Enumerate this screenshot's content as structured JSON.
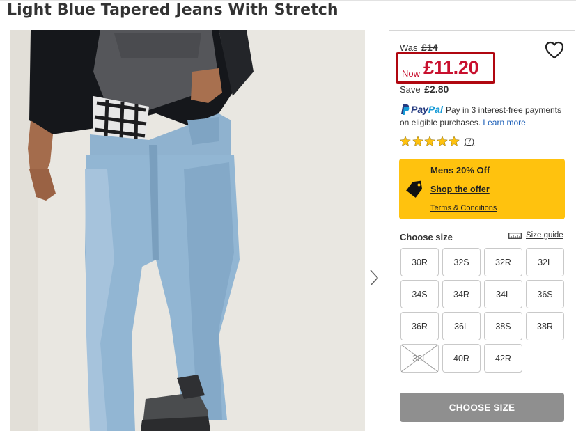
{
  "product": {
    "title": "Light Blue Tapered Jeans With Stretch"
  },
  "pricing": {
    "was_label": "Was",
    "was_price": "£14",
    "now_label": "Now",
    "now_price": "£11.20",
    "save_label": "Save",
    "save_amount": "£2.80"
  },
  "paypal": {
    "brand_pay": "Pay",
    "brand_pal": "Pal",
    "message": "Pay in 3 interest-free payments on eligible purchases.",
    "learn_more": "Learn more"
  },
  "rating": {
    "stars": 5,
    "review_count": "(7)"
  },
  "offer": {
    "title": "Mens 20% Off",
    "link": "Shop the offer",
    "terms": "Terms & Conditions"
  },
  "size_selector": {
    "label": "Choose size",
    "guide_label": "Size guide",
    "sizes": [
      {
        "label": "30R",
        "available": true
      },
      {
        "label": "32S",
        "available": true
      },
      {
        "label": "32R",
        "available": true
      },
      {
        "label": "32L",
        "available": true
      },
      {
        "label": "34S",
        "available": true
      },
      {
        "label": "34R",
        "available": true
      },
      {
        "label": "34L",
        "available": true
      },
      {
        "label": "36S",
        "available": true
      },
      {
        "label": "36R",
        "available": true
      },
      {
        "label": "36L",
        "available": true
      },
      {
        "label": "38S",
        "available": true
      },
      {
        "label": "38R",
        "available": true
      },
      {
        "label": "38L",
        "available": false
      },
      {
        "label": "40R",
        "available": true
      },
      {
        "label": "42R",
        "available": true
      }
    ]
  },
  "cta": {
    "label": "CHOOSE SIZE"
  },
  "colors": {
    "price_red": "#c8102e",
    "highlight_border": "#b00710",
    "offer_yellow": "#ffc20e",
    "cta_grey": "#8f8f8f",
    "star_yellow": "#ffc20e",
    "link_blue": "#1c5fb8"
  },
  "icons": [
    "heart-icon",
    "paypal-logo-icon",
    "star-icon",
    "price-tag-icon",
    "ruler-icon",
    "chevron-right-icon"
  ]
}
